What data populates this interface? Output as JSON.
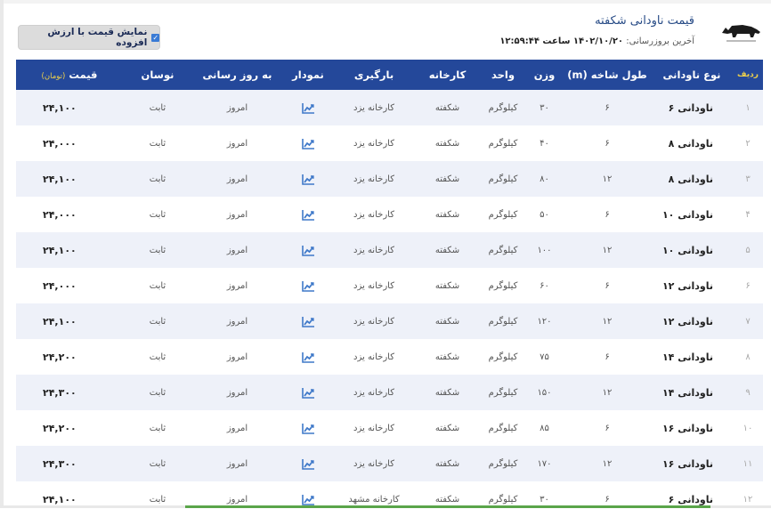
{
  "header": {
    "title": "قیمت ناودانی شکفته",
    "updated_label": "آخرین بروزرسانی:",
    "updated_value": "۱۴۰۲/۱۰/۲۰ ساعت ۱۲:۵۹:۴۴",
    "vat_toggle_label": "نمایش قیمت با ارزش افزوده",
    "vat_checked": true
  },
  "table": {
    "columns": {
      "row": "ردیف",
      "type": "نوع ناودانی",
      "length": "طول شاخه (m)",
      "weight": "وزن",
      "unit": "واحد",
      "factory": "کارخانه",
      "loading": "بارگیری",
      "chart": "نمودار",
      "updated": "به روز رسانی",
      "change": "نوسان",
      "price": "قیمت",
      "price_unit": "(تومان)"
    },
    "rows": [
      {
        "row": "۱",
        "type": "ناودانی ۶",
        "length": "۶",
        "weight": "۳۰",
        "unit": "کیلوگرم",
        "factory": "شکفته",
        "loading": "کارخانه یزد",
        "updated": "امروز",
        "change": "ثابت",
        "price": "۲۴,۱۰۰"
      },
      {
        "row": "۲",
        "type": "ناودانی ۸",
        "length": "۶",
        "weight": "۴۰",
        "unit": "کیلوگرم",
        "factory": "شکفته",
        "loading": "کارخانه یزد",
        "updated": "امروز",
        "change": "ثابت",
        "price": "۲۴,۰۰۰"
      },
      {
        "row": "۳",
        "type": "ناودانی ۸",
        "length": "۱۲",
        "weight": "۸۰",
        "unit": "کیلوگرم",
        "factory": "شکفته",
        "loading": "کارخانه یزد",
        "updated": "امروز",
        "change": "ثابت",
        "price": "۲۴,۱۰۰"
      },
      {
        "row": "۴",
        "type": "ناودانی ۱۰",
        "length": "۶",
        "weight": "۵۰",
        "unit": "کیلوگرم",
        "factory": "شکفته",
        "loading": "کارخانه یزد",
        "updated": "امروز",
        "change": "ثابت",
        "price": "۲۴,۰۰۰"
      },
      {
        "row": "۵",
        "type": "ناودانی ۱۰",
        "length": "۱۲",
        "weight": "۱۰۰",
        "unit": "کیلوگرم",
        "factory": "شکفته",
        "loading": "کارخانه یزد",
        "updated": "امروز",
        "change": "ثابت",
        "price": "۲۴,۱۰۰"
      },
      {
        "row": "۶",
        "type": "ناودانی ۱۲",
        "length": "۶",
        "weight": "۶۰",
        "unit": "کیلوگرم",
        "factory": "شکفته",
        "loading": "کارخانه یزد",
        "updated": "امروز",
        "change": "ثابت",
        "price": "۲۴,۰۰۰"
      },
      {
        "row": "۷",
        "type": "ناودانی ۱۲",
        "length": "۱۲",
        "weight": "۱۲۰",
        "unit": "کیلوگرم",
        "factory": "شکفته",
        "loading": "کارخانه یزد",
        "updated": "امروز",
        "change": "ثابت",
        "price": "۲۴,۱۰۰"
      },
      {
        "row": "۸",
        "type": "ناودانی ۱۴",
        "length": "۶",
        "weight": "۷۵",
        "unit": "کیلوگرم",
        "factory": "شکفته",
        "loading": "کارخانه یزد",
        "updated": "امروز",
        "change": "ثابت",
        "price": "۲۴,۲۰۰"
      },
      {
        "row": "۹",
        "type": "ناودانی ۱۴",
        "length": "۱۲",
        "weight": "۱۵۰",
        "unit": "کیلوگرم",
        "factory": "شکفته",
        "loading": "کارخانه یزد",
        "updated": "امروز",
        "change": "ثابت",
        "price": "۲۴,۳۰۰"
      },
      {
        "row": "۱۰",
        "type": "ناودانی ۱۶",
        "length": "۶",
        "weight": "۸۵",
        "unit": "کیلوگرم",
        "factory": "شکفته",
        "loading": "کارخانه یزد",
        "updated": "امروز",
        "change": "ثابت",
        "price": "۲۴,۲۰۰"
      },
      {
        "row": "۱۱",
        "type": "ناودانی ۱۶",
        "length": "۱۲",
        "weight": "۱۷۰",
        "unit": "کیلوگرم",
        "factory": "شکفته",
        "loading": "کارخانه یزد",
        "updated": "امروز",
        "change": "ثابت",
        "price": "۲۴,۳۰۰"
      },
      {
        "row": "۱۲",
        "type": "ناودانی ۶",
        "length": "۶",
        "weight": "۳۰",
        "unit": "کیلوگرم",
        "factory": "شکفته",
        "loading": "کارخانه مشهد",
        "updated": "امروز",
        "change": "ثابت",
        "price": "۲۴,۱۰۰"
      }
    ]
  },
  "icons": {
    "logo": "rhino-logo-icon",
    "chart": "trend-chart-icon",
    "checkbox": "checkbox-checked-icon"
  },
  "colors": {
    "header_bg": "#24489a",
    "header_accent": "#f0d24a",
    "row_alt": "#eef1f9",
    "chart_icon": "#3f79c9",
    "title": "#274b86"
  }
}
